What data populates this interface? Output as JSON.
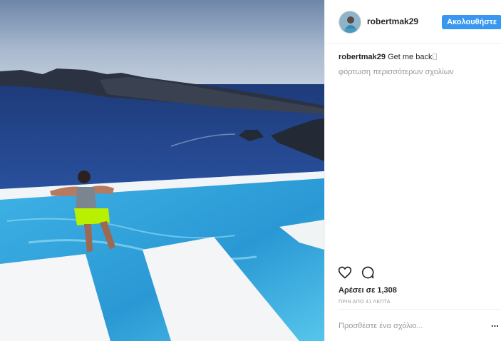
{
  "post": {
    "image_icon": "photo-infinity-pool",
    "username": "robertmak29",
    "follow_label": "Ακολουθήστε",
    "caption_user": "robertmak29",
    "caption_text": " Get me back",
    "load_more": "φόρτωση περισσότερων σχολίων",
    "likes": "Αρέσει σε 1,308",
    "time": "ΠΡΙΝ ΑΠΟ 41 ΛΕΠΤΑ",
    "comment_placeholder": "Προσθέστε ένα σχόλιο...",
    "more_label": "..."
  },
  "icons": {
    "like": "heart-icon",
    "comment": "comment-icon",
    "more": "more-options-icon"
  },
  "colors": {
    "accent": "#3897f0",
    "muted": "#999999",
    "text": "#262626"
  }
}
